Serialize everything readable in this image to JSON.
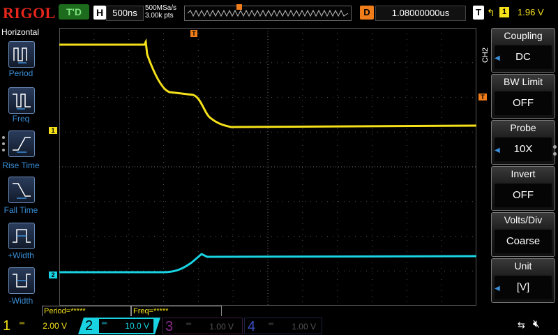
{
  "brand": "RIGOL",
  "top": {
    "trigger_status": "T'D",
    "h_badge": "H",
    "timebase": "500ns",
    "sample_rate": "500MSa/s",
    "points": "3.00k pts",
    "delay_badge": "D",
    "delay_value": "1.08000000us",
    "trig_badge": "T",
    "trig_edge": "↰",
    "trig_source": "1",
    "trig_level": "1.96 V"
  },
  "left_menu": {
    "title": "Horizontal",
    "items": [
      {
        "label": "Period"
      },
      {
        "label": "Freq"
      },
      {
        "label": "Rise Time"
      },
      {
        "label": "Fall Time"
      },
      {
        "label": "+Width"
      },
      {
        "label": "-Width"
      }
    ]
  },
  "screen": {
    "trigger_marker": "T",
    "ch1_marker": "1",
    "ch2_marker": "2",
    "trig_level_marker": "T",
    "right_channel_label": "CH2"
  },
  "measurements": {
    "period": "Period=*****",
    "freq": "Freq=*****"
  },
  "right_menu": [
    {
      "title": "Coupling",
      "value": "DC",
      "arrow": true
    },
    {
      "title": "BW Limit",
      "value": "OFF",
      "arrow": false
    },
    {
      "title": "Probe",
      "value": "10X",
      "arrow": true
    },
    {
      "title": "Invert",
      "value": "OFF",
      "arrow": false
    },
    {
      "title": "Volts/Div",
      "value": "Coarse",
      "arrow": false
    },
    {
      "title": "Unit",
      "value": "[V]",
      "arrow": true
    }
  ],
  "channels": [
    {
      "num": "1",
      "scale": "2.00 V",
      "color": "#f5e11a",
      "active": true
    },
    {
      "num": "2",
      "scale": "10.0 V",
      "color": "#19d3e3",
      "active": true
    },
    {
      "num": "3",
      "scale": "1.00 V",
      "color": "#8a2a8a",
      "active": false
    },
    {
      "num": "4",
      "scale": "1.00 V",
      "color": "#3a4ec0",
      "active": false
    }
  ],
  "status_icons": {
    "usb": "usb-icon",
    "speaker": "speaker-muted-icon"
  },
  "colors": {
    "ch1": "#f5e11a",
    "ch2": "#19d3e3",
    "trigger": "#f07d1a",
    "accent_blue": "#3a8fd8"
  }
}
